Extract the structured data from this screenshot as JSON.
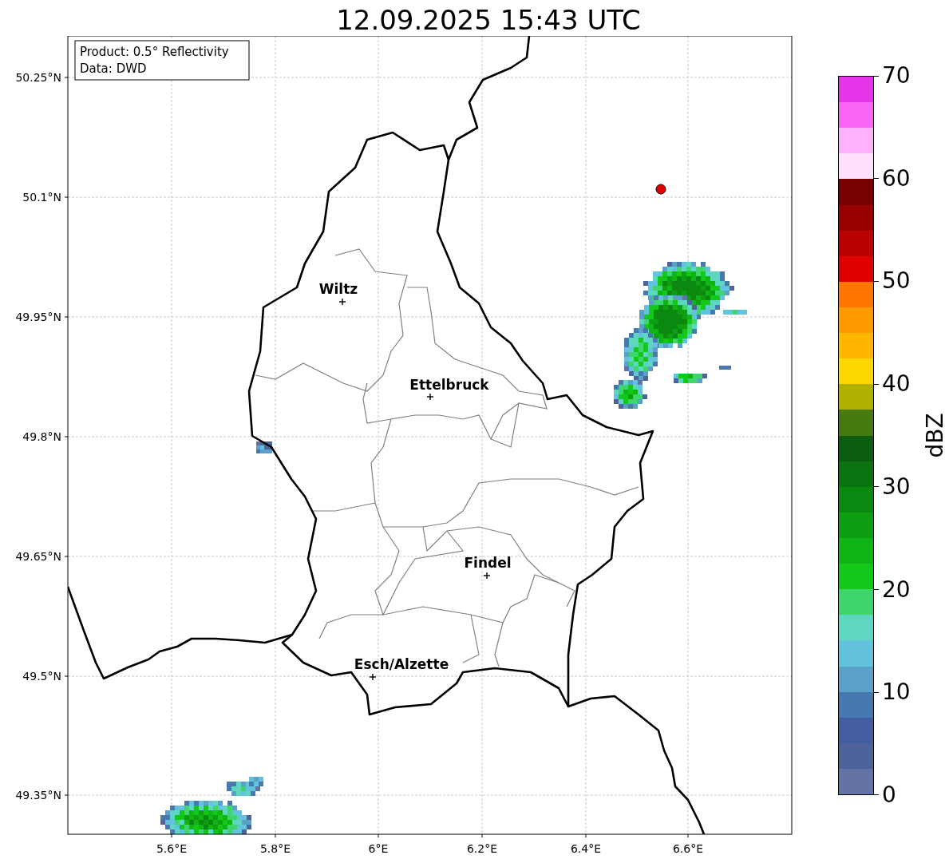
{
  "title": "12.09.2025 15:43 UTC",
  "info_box": {
    "lines": [
      "Product: 0.5° Reflectivity",
      "Data: DWD"
    ]
  },
  "map": {
    "y_ticks": [
      "50.25°N",
      "50.1°N",
      "49.95°N",
      "49.8°N",
      "49.65°N",
      "49.5°N",
      "49.35°N"
    ],
    "x_ticks": [
      "5.6°E",
      "5.8°E",
      "6°E",
      "6.2°E",
      "6.4°E",
      "6.6°E"
    ],
    "cities": [
      {
        "name": "Wiltz"
      },
      {
        "name": "Ettelbruck"
      },
      {
        "name": "Findel"
      },
      {
        "name": "Esch/Alzette"
      }
    ]
  },
  "colorbar": {
    "label": "dBZ",
    "ticks": [
      "70",
      "60",
      "50",
      "40",
      "30",
      "20",
      "10",
      "0"
    ],
    "colors": [
      {
        "color": "#e535e8"
      },
      {
        "color": "#f966f7"
      },
      {
        "color": "#fdb0fb"
      },
      {
        "color": "#ffe0ff"
      },
      {
        "color": "#770000"
      },
      {
        "color": "#990000"
      },
      {
        "color": "#bb0000"
      },
      {
        "color": "#e00000"
      },
      {
        "color": "#ff7700"
      },
      {
        "color": "#ff9a00"
      },
      {
        "color": "#ffb700"
      },
      {
        "color": "#ffd700"
      },
      {
        "color": "#b0b000"
      },
      {
        "color": "#457a10"
      },
      {
        "color": "#0b5c0f"
      },
      {
        "color": "#0a720f"
      },
      {
        "color": "#0b8810"
      },
      {
        "color": "#0e9e12"
      },
      {
        "color": "#10b414"
      },
      {
        "color": "#12c91a"
      },
      {
        "color": "#3ed56e"
      },
      {
        "color": "#5ed7c2"
      },
      {
        "color": "#63c3dc"
      },
      {
        "color": "#5aa0c8"
      },
      {
        "color": "#4878b0"
      },
      {
        "color": "#425ea0"
      },
      {
        "color": "#4e6399"
      },
      {
        "color": "#6373a6"
      }
    ]
  }
}
